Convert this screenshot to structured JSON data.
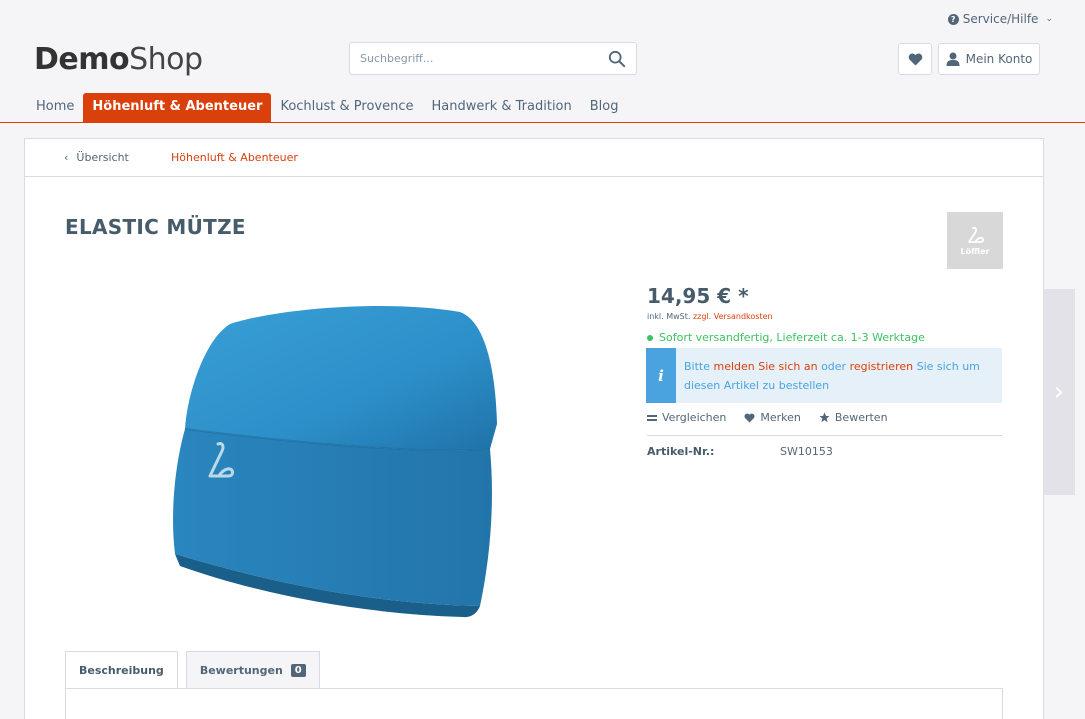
{
  "header": {
    "service_label": "Service/Hilfe",
    "logo_bold": "Demo",
    "logo_light": "Shop",
    "search_placeholder": "Suchbegriff...",
    "account_label": "Mein Konto"
  },
  "nav": {
    "items": [
      {
        "label": "Home",
        "active": false
      },
      {
        "label": "Höhenluft & Abenteuer",
        "active": true
      },
      {
        "label": "Kochlust & Provence",
        "active": false
      },
      {
        "label": "Handwerk & Tradition",
        "active": false
      },
      {
        "label": "Blog",
        "active": false
      }
    ]
  },
  "breadcrumb": {
    "back_label": "Übersicht",
    "category": "Höhenluft & Abenteuer"
  },
  "product": {
    "title": "ELASTIC MÜTZE",
    "brand": "Löffler",
    "price": "14,95 € *",
    "tax_prefix": "inkl. MwSt.",
    "shipping_link": "zzgl. Versandkosten",
    "delivery": "Sofort versandfertig, Lieferzeit ca. 1-3 Werktage",
    "info": {
      "part1": "Bitte",
      "login_link": "melden Sie sich an",
      "part2": "oder",
      "register_link": "registrieren",
      "part3": "Sie sich um diesen Artikel zu bestellen"
    },
    "actions": {
      "compare": "Vergleichen",
      "wishlist": "Merken",
      "rate": "Bewerten"
    },
    "article_nr_label": "Artikel-Nr.:",
    "article_nr_value": "SW10153"
  },
  "tabs": [
    {
      "label": "Beschreibung",
      "active": true
    },
    {
      "label": "Bewertungen",
      "count": "0",
      "active": false
    }
  ],
  "colors": {
    "accent": "#d9400b",
    "text": "#52667a",
    "info": "#4aa3df",
    "success": "#3cc261",
    "hat": "#2d8fc9"
  }
}
